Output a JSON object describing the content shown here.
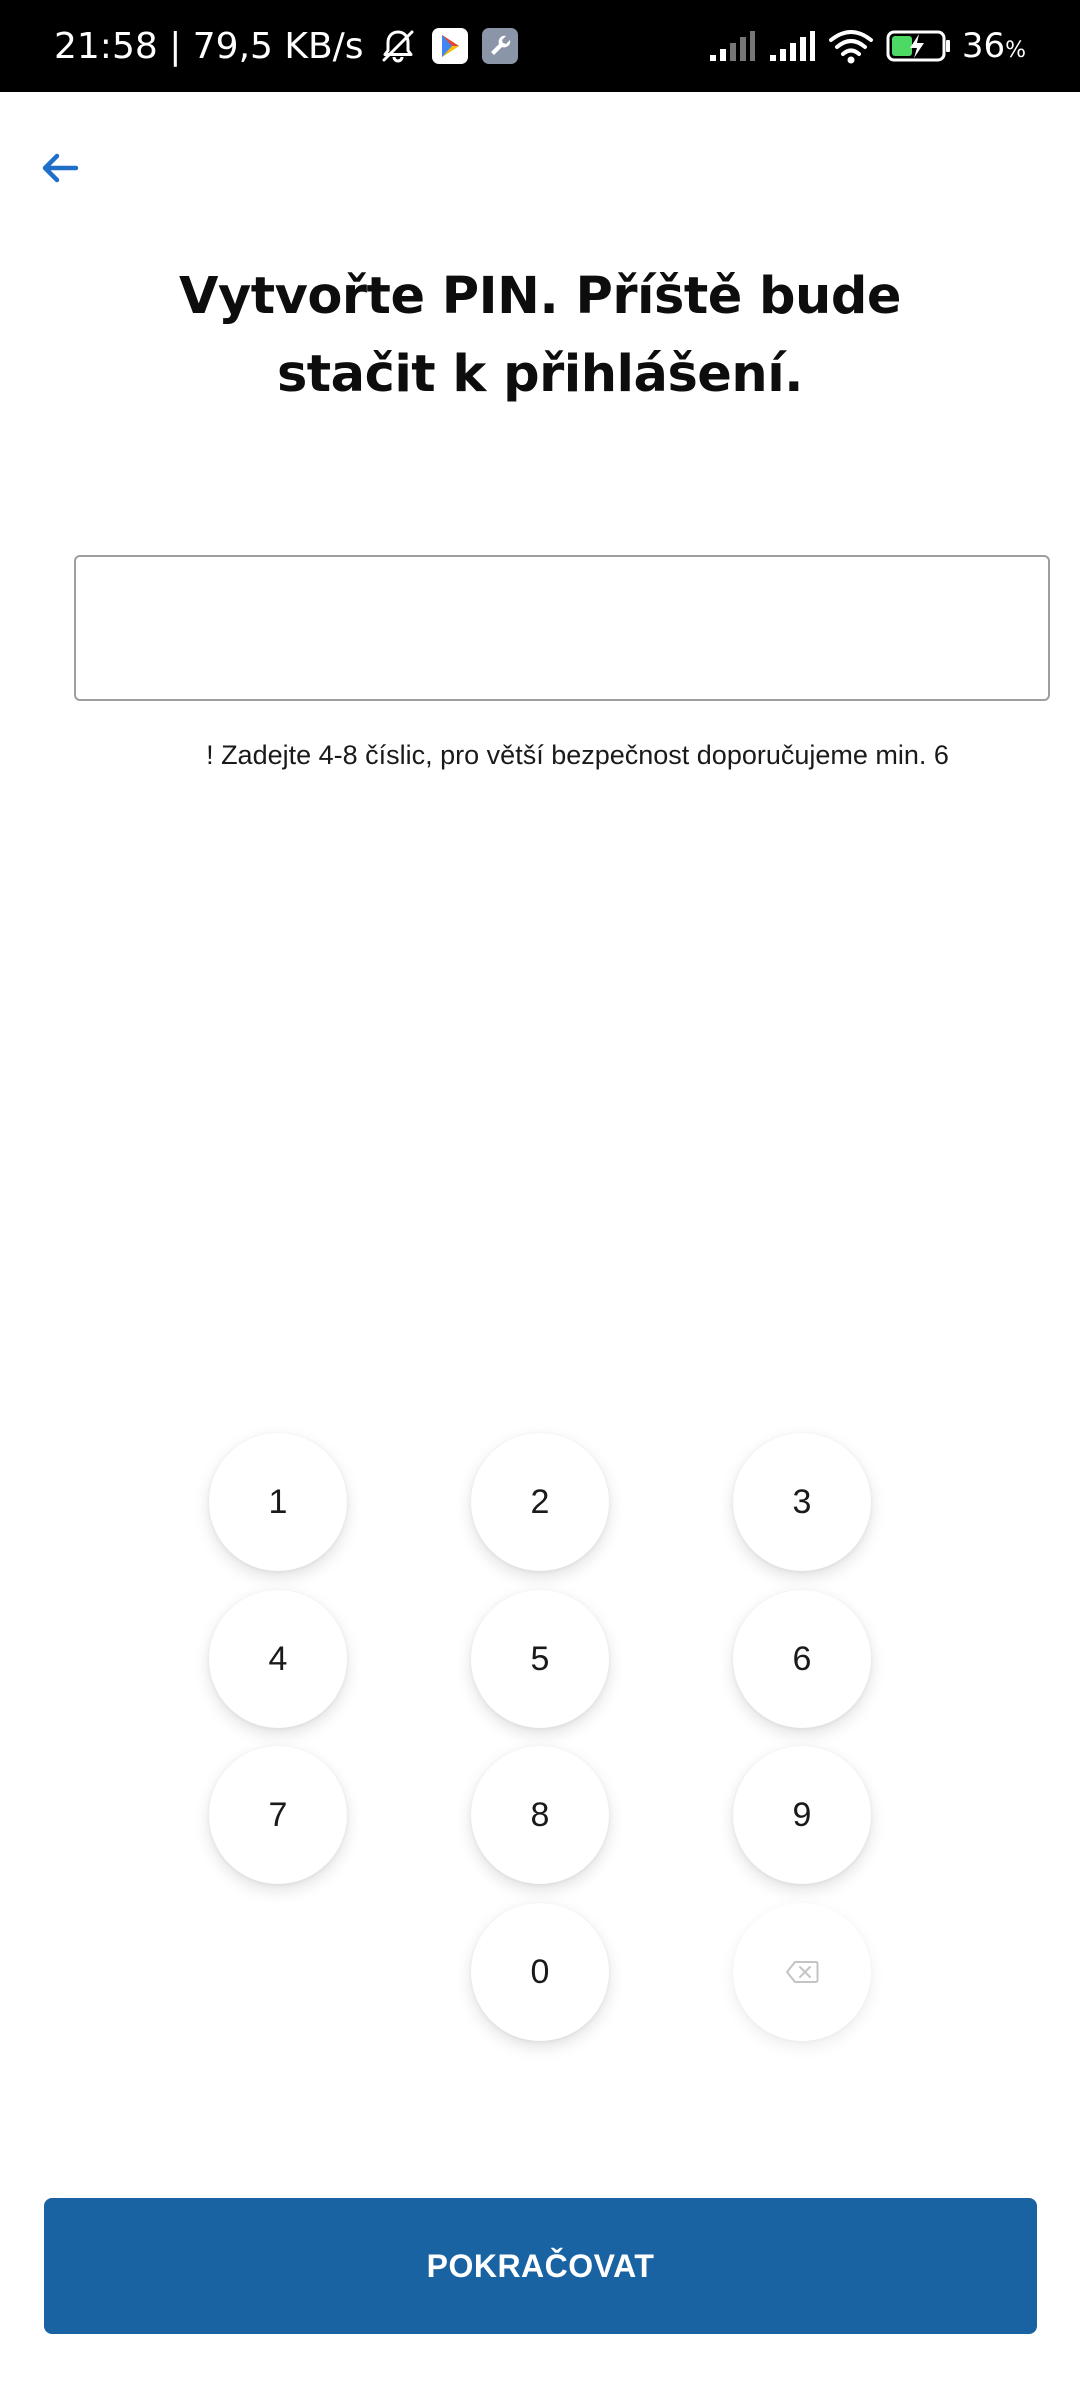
{
  "status_bar": {
    "time_speed": "21:58 | 79,5 KB/s",
    "battery_percent": "36",
    "battery_unit": "%",
    "icons": [
      "muted-bell-icon",
      "play-store-icon",
      "wrench-app-icon",
      "signal-icon",
      "signal-icon",
      "wifi-icon",
      "battery-charging-icon"
    ]
  },
  "header": {
    "back_icon": "arrow-left-icon",
    "title": "Vytvořte PIN. Příště bude stačit k přihlášení."
  },
  "pin": {
    "value": "",
    "hint": "! Zadejte 4-8 číslic, pro větší bezpečnost doporučujeme min. 6"
  },
  "keypad": {
    "keys": [
      "1",
      "2",
      "3",
      "4",
      "5",
      "6",
      "7",
      "8",
      "9",
      "0"
    ],
    "backspace_icon": "backspace-icon"
  },
  "actions": {
    "continue_label": "POKRAČOVAT"
  },
  "colors": {
    "accent": "#1963a3",
    "back_arrow": "#1f6fc9"
  }
}
